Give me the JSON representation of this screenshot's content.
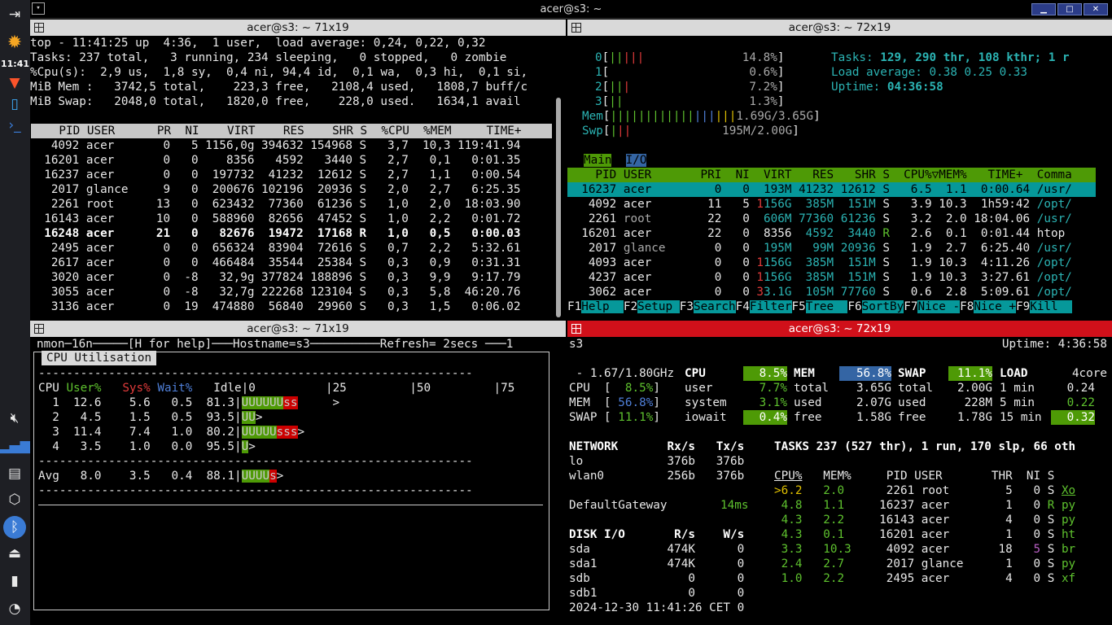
{
  "dock": {
    "clock": "11:41"
  },
  "window": {
    "title": "acer@s3: ~"
  },
  "panes": {
    "tl_title": "acer@s3: ~ 71x19",
    "tr_title": "acer@s3: ~ 72x19",
    "bl_title": "acer@s3: ~ 71x19",
    "br_title": "acer@s3: ~ 72x19"
  },
  "top": {
    "summary": [
      "top - 11:41:25 up  4:36,  1 user,  load average: 0,24, 0,22, 0,32",
      "Tasks: 237 total,   3 running, 234 sleeping,   0 stopped,   0 zombie",
      "%Cpu(s):  2,9 us,  1,8 sy,  0,4 ni, 94,4 id,  0,1 wa,  0,3 hi,  0,1 si,",
      "MiB Mem :   3742,5 total,    223,3 free,   2108,4 used,   1808,7 buff/c",
      "MiB Swap:   2048,0 total,   1820,0 free,    228,0 used.   1634,1 avail"
    ],
    "header": "    PID USER      PR  NI    VIRT    RES    SHR S  %CPU  %MEM     TIME+ ",
    "rows": [
      "   4092 acer       0   5 1156,0g 394632 154968 S   3,7  10,3 119:41.94",
      "  16201 acer       0   0    8356   4592   3440 S   2,7   0,1   0:01.35",
      "  16237 acer       0   0  197732  41232  12612 S   2,7   1,1   0:00.54",
      "   2017 glance     9   0  200676 102196  20936 S   2,0   2,7   6:25.35",
      "   2261 root      13   0  623432  77360  61236 S   1,0   2,0  18:03.90",
      "  16143 acer      10   0  588960  82656  47452 S   1,0   2,2   0:01.72",
      "  16248 acer      21   0   82676  19472  17168 R   1,0   0,5   0:00.03",
      "   2495 acer       0   0  656324  83904  72616 S   0,7   2,2   5:32.61",
      "   2617 acer       0   0  466484  35544  25384 S   0,3   0,9   0:31.31",
      "   3020 acer       0  -8   32,9g 377824 188896 S   0,3   9,9   9:17.79",
      "   3055 acer       0  -8   32,7g 222268 123104 S   0,3   5,8  46:20.76",
      "   3136 acer       0  19  474880  56840  29960 S   0,3   1,5   0:06.02"
    ]
  },
  "htop": {
    "cpu": [
      {
        "id": "0",
        "bars": "|||||",
        "pct": "14.8%"
      },
      {
        "id": "1",
        "bars": "",
        "pct": "0.6%"
      },
      {
        "id": "2",
        "bars": "|||",
        "pct": "7.2%"
      },
      {
        "id": "3",
        "bars": "||",
        "pct": "1.3%"
      }
    ],
    "mem": {
      "label": "Mem",
      "value": "1.69G/3.65G"
    },
    "swp": {
      "label": "Swp",
      "value": "195M/2.00G"
    },
    "tasks_label": "Tasks:",
    "tasks_val": "129, 290 thr, 108 kthr; 1 r",
    "load_label": "Load average:",
    "load_val": "0.38 0.25 0.33",
    "uptime_label": "Uptime:",
    "uptime_val": "04:36:58",
    "tab_main": "Main",
    "tab_io": "I/O",
    "header": "    PID USER       PRI  NI  VIRT   RES   SHR S  CPU%▽MEM%   TIME+  Comma",
    "rows": [
      {
        "pid": "16237",
        "user": "acer",
        "pri": "0",
        "ni": "0",
        "virt": "193M",
        "res": "41232",
        "shr": "12612",
        "s": "S",
        "cpu": "6.5",
        "mem": "1.1",
        "time": "0:00.64",
        "cmd": "/usr/"
      },
      {
        "pid": "4092",
        "user": "acer",
        "pri": "11",
        "ni": "5",
        "virt": "1156G",
        "res": "385M",
        "shr": "151M",
        "s": "S",
        "cpu": "3.9",
        "mem": "10.3",
        "time": "1h59:42",
        "cmd": "/opt/"
      },
      {
        "pid": "2261",
        "user": "root",
        "pri": "22",
        "ni": "0",
        "virt": "606M",
        "res": "77360",
        "shr": "61236",
        "s": "S",
        "cpu": "3.2",
        "mem": "2.0",
        "time": "18:04.06",
        "cmd": "/usr/"
      },
      {
        "pid": "16201",
        "user": "acer",
        "pri": "22",
        "ni": "0",
        "virt": "8356",
        "res": "4592",
        "shr": "3440",
        "s": "R",
        "cpu": "2.6",
        "mem": "0.1",
        "time": "0:01.44",
        "cmd": "htop"
      },
      {
        "pid": "2017",
        "user": "glance",
        "pri": "0",
        "ni": "0",
        "virt": "195M",
        "res": "99M",
        "shr": "20936",
        "s": "S",
        "cpu": "1.9",
        "mem": "2.7",
        "time": "6:25.40",
        "cmd": "/usr/"
      },
      {
        "pid": "4093",
        "user": "acer",
        "pri": "0",
        "ni": "0",
        "virt": "1156G",
        "res": "385M",
        "shr": "151M",
        "s": "S",
        "cpu": "1.9",
        "mem": "10.3",
        "time": "4:11.26",
        "cmd": "/opt/"
      },
      {
        "pid": "4237",
        "user": "acer",
        "pri": "0",
        "ni": "0",
        "virt": "1156G",
        "res": "385M",
        "shr": "151M",
        "s": "S",
        "cpu": "1.9",
        "mem": "10.3",
        "time": "3:27.61",
        "cmd": "/opt/"
      },
      {
        "pid": "3062",
        "user": "acer",
        "pri": "0",
        "ni": "0",
        "virt": "33.1G",
        "res": "105M",
        "shr": "77760",
        "s": "S",
        "cpu": "0.6",
        "mem": "2.8",
        "time": "5:09.61",
        "cmd": "/opt/"
      }
    ],
    "fkeys": [
      {
        "k": "F1",
        "l": "Help  "
      },
      {
        "k": "F2",
        "l": "Setup "
      },
      {
        "k": "F3",
        "l": "Search"
      },
      {
        "k": "F4",
        "l": "Filter"
      },
      {
        "k": "F5",
        "l": "Tree  "
      },
      {
        "k": "F6",
        "l": "SortBy"
      },
      {
        "k": "F7",
        "l": "Nice -"
      },
      {
        "k": "F8",
        "l": "Nice +"
      },
      {
        "k": "F9",
        "l": "Kill  "
      }
    ]
  },
  "nmon": {
    "topline": "nmon─16n─────[H for help]───Hostname=s3──────────Refresh= 2secs ───1",
    "box_title": "CPU Utilisation",
    "hdr_cpu": "CPU ",
    "hdr_user": "User%",
    "hdr_sys": "Sys%",
    "hdr_wait": "Wait%",
    "hdr_idle": "Idle",
    "scale": "|0          |25         |50         |75",
    "rows": [
      {
        "line": "  1  12.6    5.6   0.5  81.3",
        "u": "UUUUUU",
        "s": "ss",
        "w": "",
        "tail": "     >"
      },
      {
        "line": "  2   4.5    1.5   0.5  93.5",
        "u": "UU",
        "s": "",
        "w": "",
        "tail": ">"
      },
      {
        "line": "  3  11.4    7.4   1.0  80.2",
        "u": "UUUUU",
        "s": "sss",
        "w": "",
        "tail": ">"
      },
      {
        "line": "  4   3.5    1.0   0.0  95.5",
        "u": "U",
        "s": "",
        "w": "",
        "tail": ">"
      }
    ],
    "dash": "--------------------------------------------------------------",
    "avg": {
      "line": "Avg   8.0    3.5   0.4  88.1",
      "u": "UUUU",
      "s": "s",
      "tail": ">"
    }
  },
  "glances": {
    "host": "s3",
    "uptime": "Uptime: 4:36:58",
    "freq": " - 1.67/1.80GHz",
    "cpu_lbl": "CPU",
    "cpu_pct": "8.5%",
    "mem_lbl": "MEM",
    "mem_pct": "56.8%",
    "swap_lbl": "SWAP",
    "swap_pct": "11.1%",
    "load_lbl": "LOAD",
    "load_cores": "4core",
    "quick": [
      {
        "l": "CPU  [",
        "v": "  8.5%",
        "e": "]"
      },
      {
        "l": "MEM  [",
        "v": " 56.8%",
        "e": "]"
      },
      {
        "l": "SWAP [",
        "v": " 11.1%",
        "e": "]"
      }
    ],
    "cpu_rows": [
      {
        "k": "user",
        "v": "7.7%"
      },
      {
        "k": "system",
        "v": "3.1%"
      },
      {
        "k": "iowait",
        "v": "0.4%"
      }
    ],
    "mem_rows": [
      {
        "k": "total",
        "v": "3.65G"
      },
      {
        "k": "used",
        "v": "2.07G"
      },
      {
        "k": "free",
        "v": "1.58G"
      }
    ],
    "swap_rows": [
      {
        "k": "total",
        "v": "2.00G"
      },
      {
        "k": "used",
        "v": "228M"
      },
      {
        "k": "free",
        "v": "1.78G"
      }
    ],
    "load_rows": [
      {
        "k": "1 min",
        "v": "0.24"
      },
      {
        "k": "5 min",
        "v": "0.22"
      },
      {
        "k": "15 min",
        "v": "0.32"
      }
    ],
    "net_hdr": "NETWORK       Rx/s   Tx/s",
    "net_rows": [
      "lo            376b   376b",
      "wlan0         256b   376b"
    ],
    "gw_lbl": "DefaultGateway",
    "gw_val": "14ms",
    "disk_hdr": "DISK I/O       R/s    W/s",
    "disk_rows": [
      "sda           474K      0",
      "sda1          474K      0",
      "sdb              0      0",
      "sdb1             0      0"
    ],
    "datetime": "2024-12-30 11:41:26 CET 0",
    "tasks": "TASKS 237 (527 thr), 1 run, 170 slp, 66 oth",
    "proc_hdr": {
      "cpu": "CPU%",
      "mem": "MEM%",
      "rest": "     PID USER       THR  NI S"
    },
    "procs": [
      {
        "cpu": ">6.2",
        "mem": "2.0",
        "pid": "2261",
        "user": "root",
        "thr": "5",
        "ni": "0",
        "s": "S",
        "cmd": "Xo"
      },
      {
        "cpu": " 4.8",
        "mem": "1.1",
        "pid": "16237",
        "user": "acer",
        "thr": "1",
        "ni": "0",
        "s": "R",
        "cmd": "py"
      },
      {
        "cpu": " 4.3",
        "mem": "2.2",
        "pid": "16143",
        "user": "acer",
        "thr": "4",
        "ni": "0",
        "s": "S",
        "cmd": "py"
      },
      {
        "cpu": " 4.3",
        "mem": "0.1",
        "pid": "16201",
        "user": "acer",
        "thr": "1",
        "ni": "0",
        "s": "S",
        "cmd": "ht"
      },
      {
        "cpu": " 3.3",
        "mem": "10.3",
        "pid": "4092",
        "user": "acer",
        "thr": "18",
        "ni": "5",
        "s": "S",
        "cmd": "br"
      },
      {
        "cpu": " 2.4",
        "mem": "2.7",
        "pid": "2017",
        "user": "glance",
        "thr": "1",
        "ni": "0",
        "s": "S",
        "cmd": "py"
      },
      {
        "cpu": " 1.0",
        "mem": "2.2",
        "pid": "2495",
        "user": "acer",
        "thr": "4",
        "ni": "0",
        "s": "S",
        "cmd": "xf"
      }
    ]
  },
  "colors": {
    "htop_green": "#4e9a06",
    "htop_cyan": "#06989a",
    "glances_blue": "#3465a4",
    "titlebar_red": "#d0101a"
  }
}
